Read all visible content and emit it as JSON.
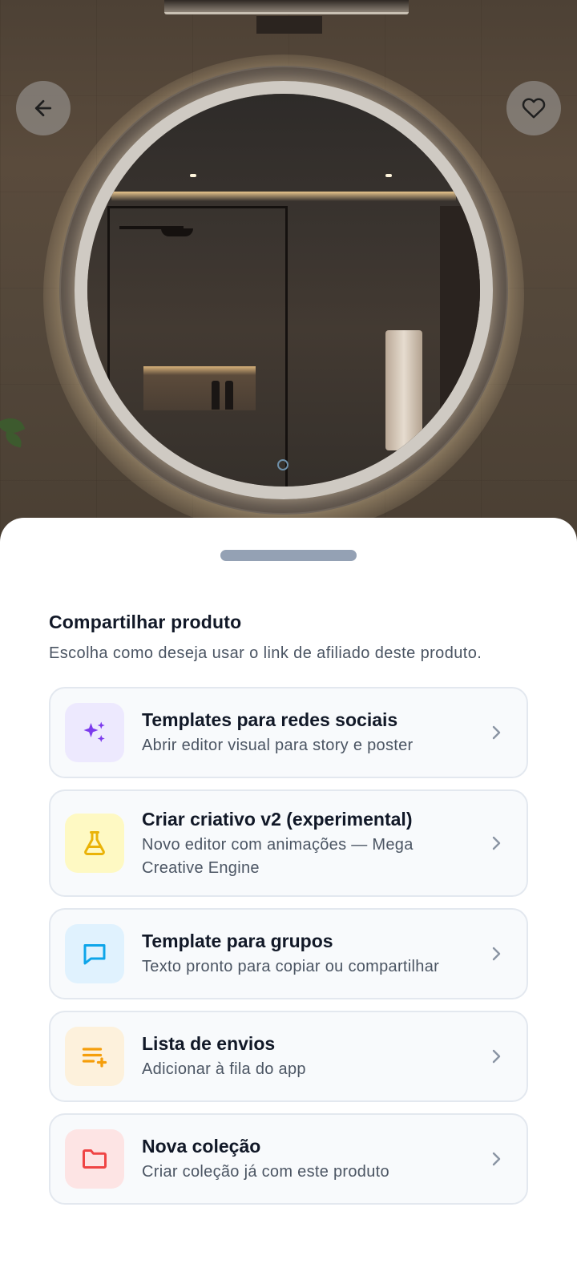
{
  "hero": {
    "back_icon": "arrow-left-icon",
    "favorite_icon": "heart-outline-icon"
  },
  "sheet": {
    "title": "Compartilhar produto",
    "subtitle": "Escolha como deseja usar o link de afiliado deste produto.",
    "options": [
      {
        "title": "Templates para redes sociais",
        "description": "Abrir editor visual para story e poster",
        "icon": "sparkles-icon",
        "icon_bg": "#ede9fe",
        "icon_color": "#7c3aed"
      },
      {
        "title": "Criar criativo v2 (experimental)",
        "description": "Novo editor com animações — Mega Creative Engine",
        "icon": "flask-icon",
        "icon_bg": "#fef9c3",
        "icon_color": "#eab308"
      },
      {
        "title": "Template para grupos",
        "description": "Texto pronto para copiar ou compartilhar",
        "icon": "message-square-icon",
        "icon_bg": "#e0f2fe",
        "icon_color": "#0ea5e9"
      },
      {
        "title": "Lista de envios",
        "description": "Adicionar à fila do app",
        "icon": "list-plus-icon",
        "icon_bg": "#fdf1dc",
        "icon_color": "#f59e0b"
      },
      {
        "title": "Nova coleção",
        "description": "Criar coleção já com este produto",
        "icon": "folder-icon",
        "icon_bg": "#fde4e4",
        "icon_color": "#ef4444"
      }
    ]
  }
}
